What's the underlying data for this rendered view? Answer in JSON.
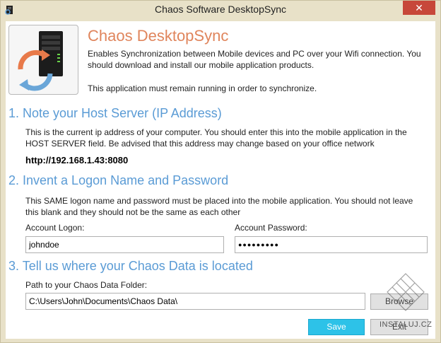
{
  "window": {
    "title": "Chaos Software DesktopSync",
    "close_glyph": "✕"
  },
  "header": {
    "title": "Chaos DesktopSync",
    "description": "Enables Synchronization between Mobile devices and PC over your Wifi connection.  You should download and install our mobile application products.",
    "note": "This application must remain running in order to synchronize."
  },
  "section1": {
    "heading": "1.  Note your Host Server (IP Address)",
    "text": "This is the current ip address of your computer.  You should enter this into the mobile application in the HOST SERVER field.  Be advised that this address may change based on your office network",
    "ip": "http://192.168.1.43:8080"
  },
  "section2": {
    "heading": "2.  Invent a Logon Name and Password",
    "text": "This SAME logon name and password must be placed into the mobile application.  You should not leave this blank and they should not be the same as each other",
    "logon_label": "Account Logon:",
    "logon_value": "johndoe",
    "password_label": "Account Password:",
    "password_value": "●●●●●●●●●"
  },
  "section3": {
    "heading": "3.  Tell us where your Chaos Data is located",
    "path_label": "Path to your Chaos Data Folder:",
    "path_value": "C:\\Users\\John\\Documents\\Chaos Data\\",
    "browse_label": "Browse"
  },
  "footer": {
    "save_label": "Save",
    "exit_label": "Exit"
  },
  "watermark": {
    "text": "INSTALUJ.CZ"
  },
  "colors": {
    "accent_title": "#e0855c",
    "heading": "#5a9bd5",
    "save_button": "#2dc2e8",
    "close_button": "#c7473a"
  }
}
